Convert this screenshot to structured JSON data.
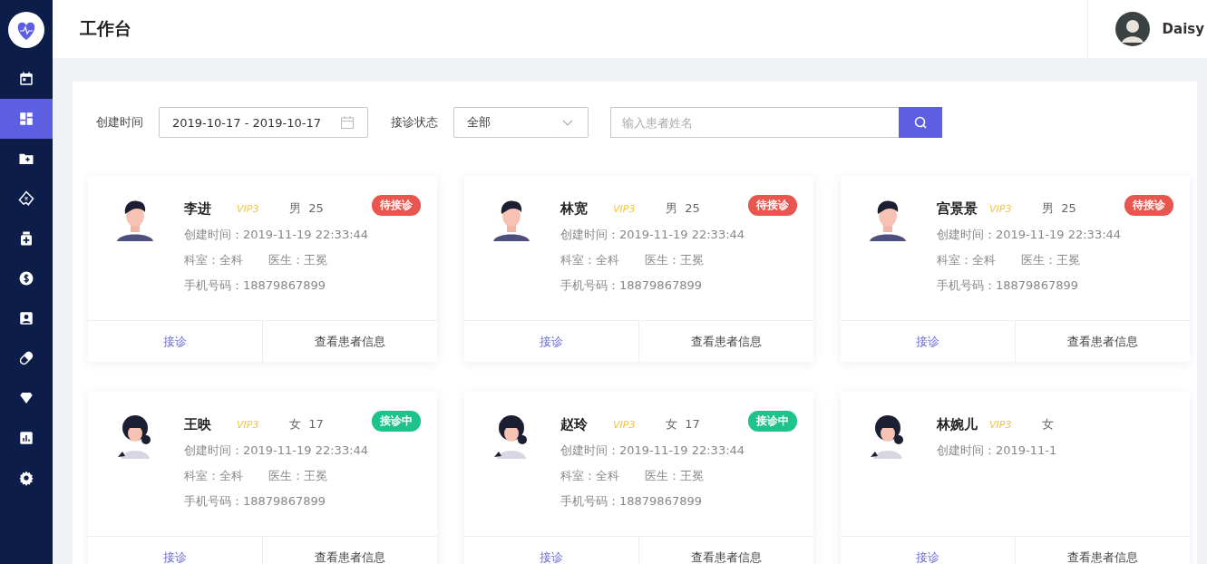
{
  "sidebar": {
    "items": [
      {
        "selected": false
      },
      {
        "selected": true
      },
      {
        "selected": false
      },
      {
        "selected": false
      },
      {
        "selected": false
      },
      {
        "selected": false
      },
      {
        "selected": false
      },
      {
        "selected": false
      },
      {
        "selected": false
      },
      {
        "selected": false
      },
      {
        "selected": false
      }
    ]
  },
  "header": {
    "title": "工作台",
    "user": {
      "name": "Daisy"
    }
  },
  "filters": {
    "date_label": "创建时间",
    "date_value": "2019-10-17 - 2019-10-17",
    "status_label": "接诊状态",
    "status_value": "全部",
    "search": {
      "placeholder": "输入患者姓名"
    }
  },
  "patients": [
    {
      "kind": "male",
      "name": "李进",
      "vip": "VIP3",
      "gender_age": "男  25",
      "status": {
        "text": "待接诊",
        "color": "#e9564f"
      },
      "created": "创建时间：2019-11-19 22:33:44",
      "department": "科室：全科",
      "doctor": "医生：王冕",
      "phone": "手机号码：18879867899",
      "actions": [
        "接诊",
        "查看患者信息"
      ]
    },
    {
      "kind": "male",
      "name": "林宽",
      "vip": "VIP3",
      "gender_age": "男  25",
      "status": {
        "text": "待接诊",
        "color": "#e9564f"
      },
      "created": "创建时间：2019-11-19 22:33:44",
      "department": "科室：全科",
      "doctor": "医生：王冕",
      "phone": "手机号码：18879867899",
      "actions": [
        "接诊",
        "查看患者信息"
      ]
    },
    {
      "kind": "male",
      "name": "宫景景",
      "vip": "VIP3",
      "gender_age": "男  25",
      "status": {
        "text": "待接诊",
        "color": "#e9564f"
      },
      "created": "创建时间：2019-11-19 22:33:44",
      "department": "科室：全科",
      "doctor": "医生：王冕",
      "phone": "手机号码：18879867899",
      "actions": [
        "接诊",
        "查看患者信息"
      ]
    },
    {
      "kind": "female",
      "name": "王映",
      "vip": "VIP3",
      "gender_age": "女  17",
      "status": {
        "text": "接诊中",
        "color": "#1ec28b"
      },
      "created": "创建时间：2019-11-19 22:33:44",
      "department": "科室：全科",
      "doctor": "医生：王冕",
      "phone": "手机号码：18879867899",
      "actions": [
        "接诊",
        "查看患者信息"
      ]
    },
    {
      "kind": "female",
      "name": "赵玲",
      "vip": "VIP3",
      "gender_age": "女  17",
      "status": {
        "text": "接诊中",
        "color": "#1ec28b"
      },
      "created": "创建时间：2019-11-19 22:33:44",
      "department": "科室：全科",
      "doctor": "医生：王冕",
      "phone": "手机号码：18879867899",
      "actions": [
        "接诊",
        "查看患者信息"
      ]
    },
    {
      "kind": "female",
      "name": "林婉儿",
      "vip": "VIP3",
      "gender_age": "女",
      "created": "创建时间：2019-11-1",
      "actions": [
        "接诊",
        "查看患者信息"
      ]
    }
  ]
}
